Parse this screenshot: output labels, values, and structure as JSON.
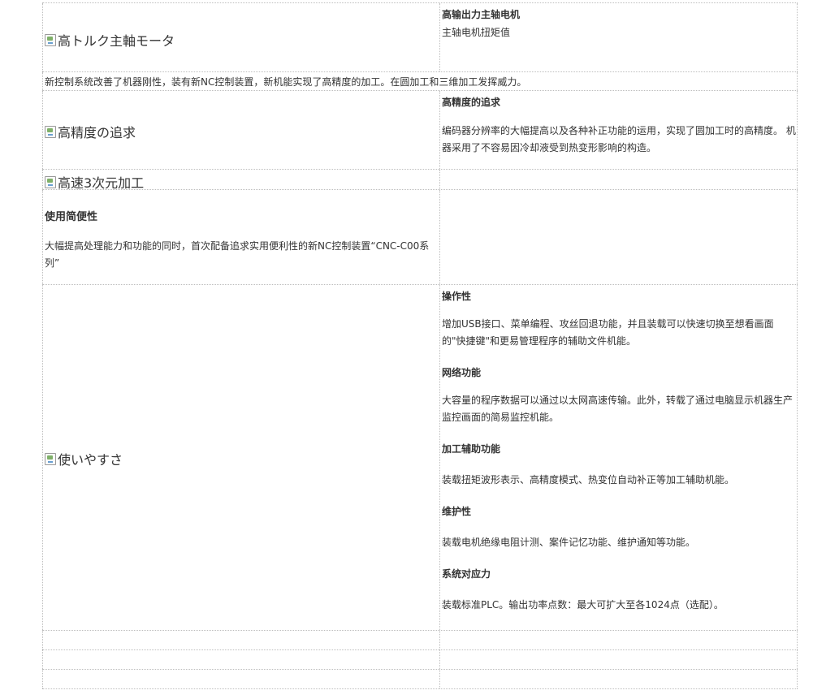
{
  "rows": {
    "r1": {
      "img_alt": "高トルク主軸モータ",
      "title": "高输出力主轴电机",
      "text": "主轴电机扭矩值"
    },
    "r2": {
      "text": "新控制系统改善了机器刚性，装有新NC控制装置，新机能实现了高精度的加工。在圆加工和三维加工发挥威力。"
    },
    "r3": {
      "img_alt": "高精度の追求",
      "title": "高精度的追求",
      "text_line1": "编码器分辨率的大幅提高以及各种补正功能的运用，实现了圆加工时的高精度。 机",
      "text_line2": "器采用了不容易因冷却液受到热变形影响的构造。"
    },
    "r4": {
      "img_alt": "高速3次元加工"
    },
    "r5": {
      "title": "使用简便性",
      "text_line1": "大幅提高处理能力和功能的同时，首次配备追求实用便利性的新NC控制装置“CNC-C00系",
      "text_line2": "列”"
    },
    "r6": {
      "img_alt": "使いやすさ",
      "sections": [
        {
          "title": "操作性",
          "line1": "增加USB接口、菜单编程、攻丝回退功能，并且装载可以快速切换至想看画面",
          "line2": "的\"快捷键\"和更易管理程序的辅助文件机能。"
        },
        {
          "title": "网络功能",
          "line1": "大容量的程序数据可以通过以太网高速传输。此外，转载了通过电脑显示机器生产",
          "line2": "监控画面的简易监控机能。"
        },
        {
          "title": "加工辅助功能",
          "line1": "装载扭矩波形表示、高精度模式、热变位自动补正等加工辅助机能。"
        },
        {
          "title": "维护性",
          "line1": "装载电机绝缘电阻计测、案件记忆功能、维护通知等功能。"
        },
        {
          "title": "系统对应力",
          "line1": "装载标准PLC。输出功率点数：最大可扩大至各1024点（选配）。"
        }
      ]
    }
  }
}
